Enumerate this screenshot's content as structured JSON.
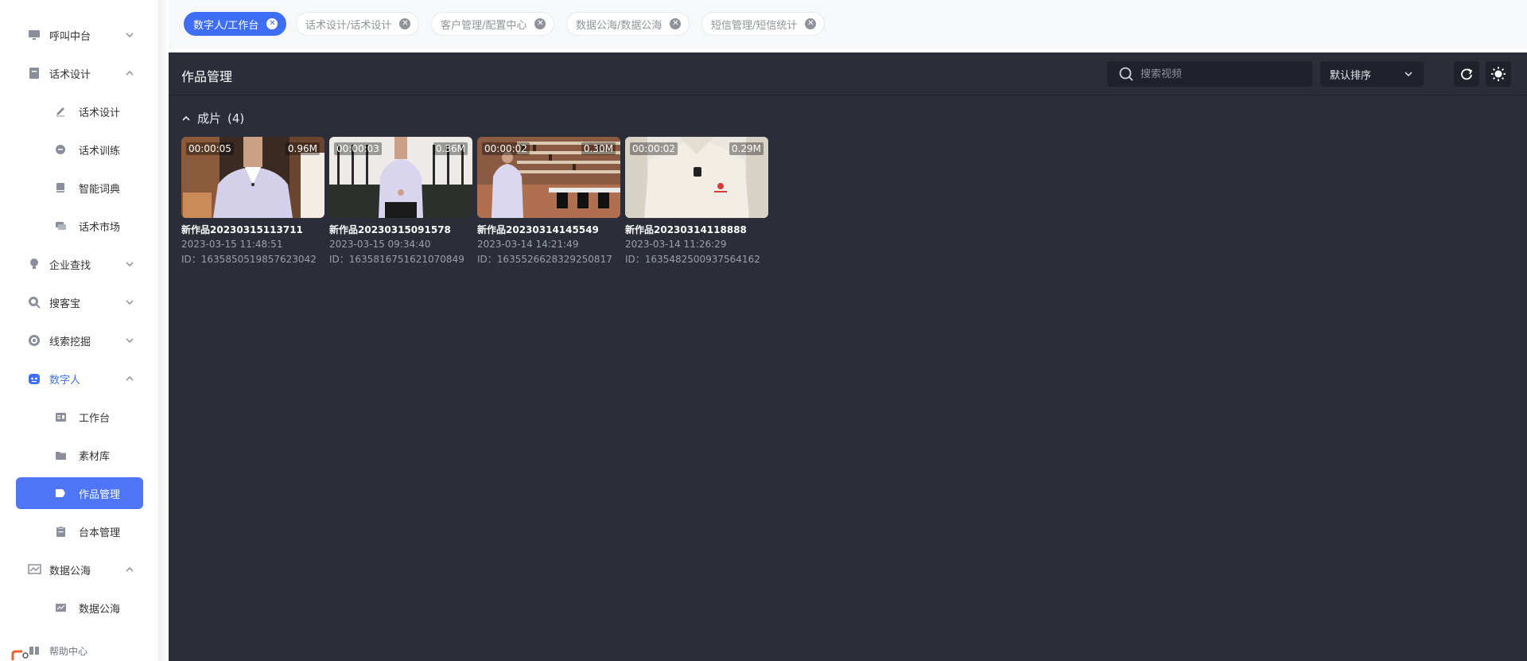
{
  "sidebar": {
    "items": [
      {
        "label": "呼叫中台",
        "icon": "monitor-icon"
      },
      {
        "label": "话术设计",
        "icon": "document-icon"
      },
      {
        "label": "话术设计",
        "icon": "pen-icon"
      },
      {
        "label": "话术训练",
        "icon": "chat-bubble-icon"
      },
      {
        "label": "智能词典",
        "icon": "book-icon"
      },
      {
        "label": "话术市场",
        "icon": "messages-icon"
      },
      {
        "label": "企业查找",
        "icon": "bulb-icon"
      },
      {
        "label": "搜客宝",
        "icon": "search-circle-icon"
      },
      {
        "label": "线索挖掘",
        "icon": "target-icon"
      },
      {
        "label": "数字人",
        "icon": "robot-icon"
      },
      {
        "label": "工作台",
        "icon": "workbench-icon"
      },
      {
        "label": "素材库",
        "icon": "folder-icon"
      },
      {
        "label": "作品管理",
        "icon": "video-tag-icon"
      },
      {
        "label": "台本管理",
        "icon": "clipboard-icon"
      },
      {
        "label": "数据公海",
        "icon": "chart-line-icon"
      },
      {
        "label": "数据公海",
        "icon": "chart-box-icon"
      },
      {
        "label": "帮助中心",
        "icon": "help-grid-icon"
      }
    ]
  },
  "tabs": [
    {
      "label": "数字人/工作台",
      "active": true
    },
    {
      "label": "话术设计/话术设计",
      "active": false
    },
    {
      "label": "客户管理/配置中心",
      "active": false
    },
    {
      "label": "数据公海/数据公海",
      "active": false
    },
    {
      "label": "短信管理/短信统计",
      "active": false
    }
  ],
  "main": {
    "title": "作品管理",
    "search_placeholder": "搜索视频",
    "sort_label": "默认排序",
    "section_label": "成片",
    "section_count": "(4)",
    "works": [
      {
        "duration": "00:00:05",
        "size": "0.96M",
        "name": "新作品20230315113711",
        "date": "2023-03-15 11:48:51",
        "id": "ID：1635850519857623042",
        "scene": "office"
      },
      {
        "duration": "00:00:03",
        "size": "0.36M",
        "name": "新作品20230315091578",
        "date": "2023-03-15 09:34:40",
        "id": "ID：1635816751621070849",
        "scene": "studio"
      },
      {
        "duration": "00:00:02",
        "size": "0.30M",
        "name": "新作品20230314145549",
        "date": "2023-03-14 14:21:49",
        "id": "ID：1635526628329250817",
        "scene": "library"
      },
      {
        "duration": "00:00:02",
        "size": "0.29M",
        "name": "新作品20230314118888",
        "date": "2023-03-14 11:26:29",
        "id": "ID：1635482500937564162",
        "scene": "closeup"
      }
    ]
  },
  "colors": {
    "accent": "#3f6ef6",
    "active_nav": "#4f76f6",
    "panel_bg": "#2b2e39",
    "input_bg": "#1f222b"
  }
}
